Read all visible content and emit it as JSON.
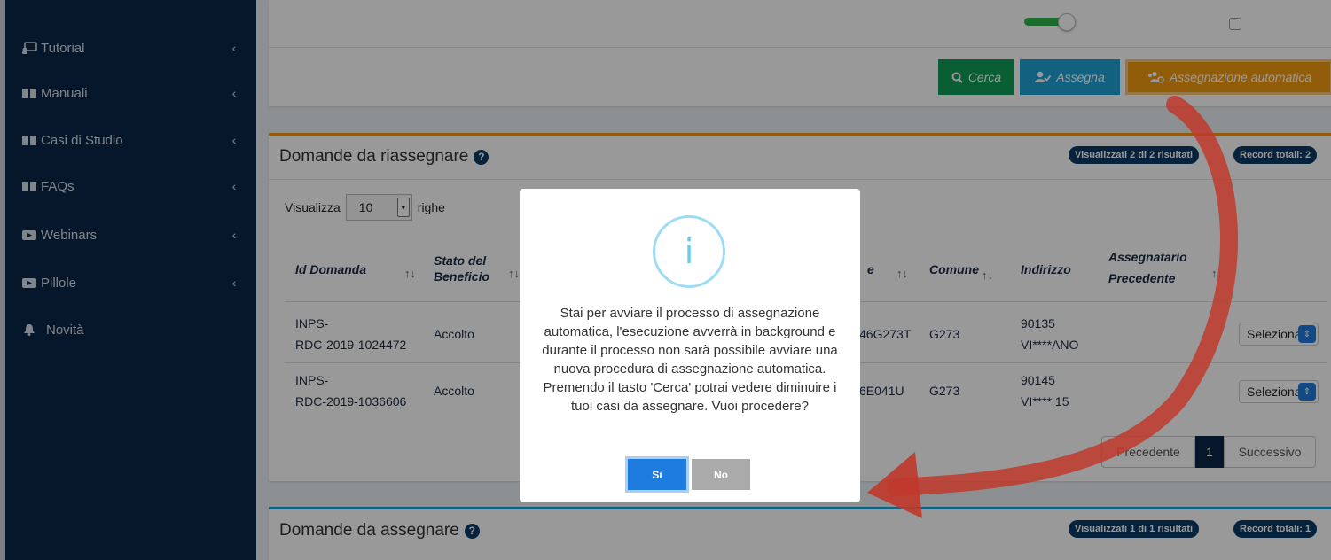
{
  "sidebar": {
    "items": [
      {
        "label": "Tutorial",
        "icon": "tutorial-icon",
        "chevron": "‹"
      },
      {
        "label": "Manuali",
        "icon": "book-icon",
        "chevron": "‹"
      },
      {
        "label": "Casi di Studio",
        "icon": "book-icon",
        "chevron": "‹"
      },
      {
        "label": "FAQs",
        "icon": "book-icon",
        "chevron": "‹"
      },
      {
        "label": "Webinars",
        "icon": "video-icon",
        "chevron": "‹"
      },
      {
        "label": "Pillole",
        "icon": "video-icon",
        "chevron": "‹"
      },
      {
        "label": "Novità",
        "icon": "bell-icon",
        "chevron": ""
      }
    ]
  },
  "toolbar": {
    "cerca_label": "Cerca",
    "assegna_label": "Assegna",
    "auto_label": "Assegnazione automatica"
  },
  "panel_riassegnare": {
    "title": "Domande da riassegnare",
    "badge_visualizzati": "Visualizzati 2 di 2 risultati",
    "badge_totali": "Record totali: 2",
    "show_prefix": "Visualizza",
    "show_value": "10",
    "show_suffix": "righe",
    "headers": {
      "id": "Id Domanda",
      "stato_1": "Stato del",
      "stato_2": "Beneficio",
      "cf_tail": "e",
      "comune": "Comune",
      "indirizzo": "Indirizzo",
      "assegnatario_1": "Assegnatario",
      "assegnatario_2": "Precedente",
      "sort_glyph": "↑↓"
    },
    "rows": [
      {
        "id_1": "INPS-",
        "id_2": "RDC-2019-1024472",
        "stato": "Accolto",
        "cf": "46G273T",
        "comune": "G273",
        "ind_1": "90135",
        "ind_2": "VI****ANO",
        "select": "Seleziona"
      },
      {
        "id_1": "INPS-",
        "id_2": "RDC-2019-1036606",
        "stato": "Accolto",
        "cf": "6E041U",
        "comune": "G273",
        "ind_1": "90145",
        "ind_2": "VI**** 15",
        "select": "Seleziona"
      }
    ],
    "pager": {
      "prev": "Precedente",
      "page": "1",
      "next": "Successivo"
    }
  },
  "panel_assegnare": {
    "title": "Domande da assegnare",
    "badge_visualizzati": "Visualizzati 1 di 1 risultati",
    "badge_totali": "Record totali: 1"
  },
  "modal": {
    "icon": "i",
    "message": "Stai per avviare il processo di assegnazione automatica, l'esecuzione avverrà in background e durante il processo non sarà possibile avviare una nuova procedura di assegnazione automatica. Premendo il tasto 'Cerca' potrai vedere diminuire i tuoi casi da assegnare. Vuoi procedere?",
    "yes_label": "Si",
    "no_label": "No"
  },
  "colors": {
    "sidebar": "#0b2748",
    "accent_orange": "#f39c12",
    "accent_green": "#0f9d58",
    "accent_blue": "#20a2d8",
    "arrow": "#c0392b"
  }
}
